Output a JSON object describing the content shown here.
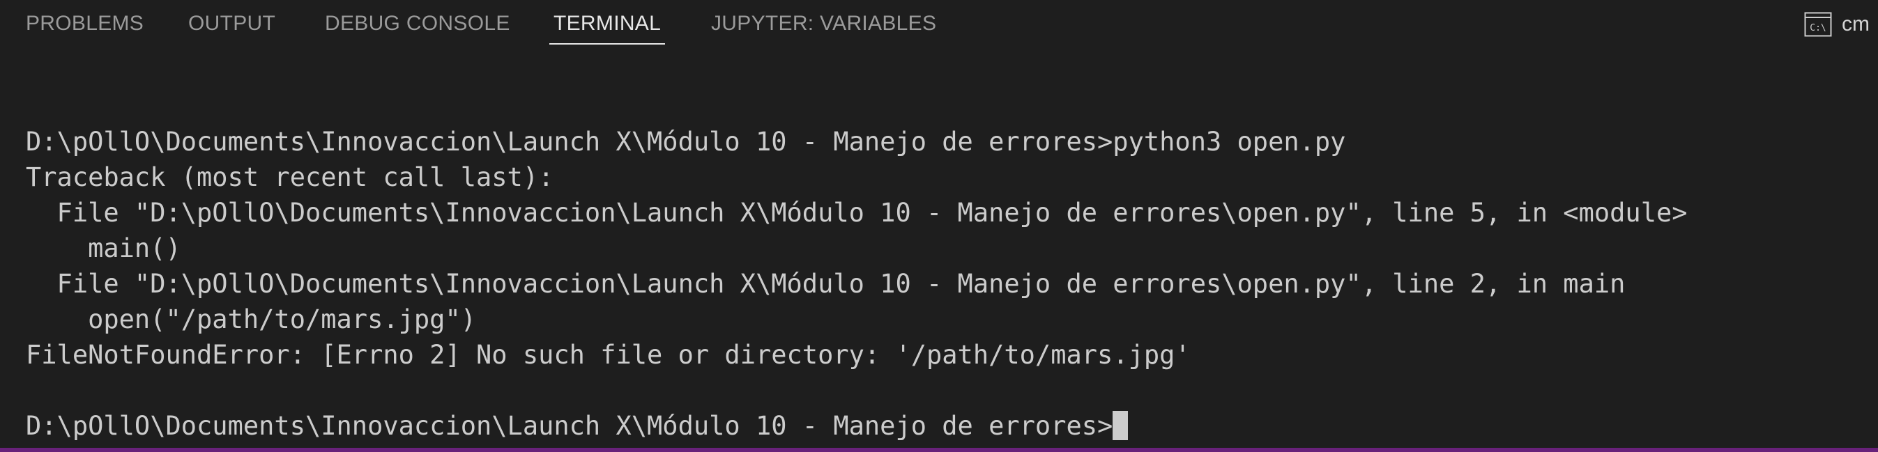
{
  "tabs": [
    {
      "label": "PROBLEMS",
      "active": false
    },
    {
      "label": "OUTPUT",
      "active": false
    },
    {
      "label": "DEBUG CONSOLE",
      "active": false
    },
    {
      "label": "TERMINAL",
      "active": true
    },
    {
      "label": "JUPYTER: VARIABLES",
      "active": false
    }
  ],
  "terminal_selector": {
    "label": "cm",
    "icon": "terminal-cmd-icon"
  },
  "terminal": {
    "lines": [
      "D:\\pOllO\\Documents\\Innovaccion\\Launch X\\Módulo 10 - Manejo de errores>python3 open.py",
      "Traceback (most recent call last):",
      "  File \"D:\\pOllO\\Documents\\Innovaccion\\Launch X\\Módulo 10 - Manejo de errores\\open.py\", line 5, in <module>",
      "    main()",
      "  File \"D:\\pOllO\\Documents\\Innovaccion\\Launch X\\Módulo 10 - Manejo de errores\\open.py\", line 2, in main",
      "    open(\"/path/to/mars.jpg\")",
      "FileNotFoundError: [Errno 2] No such file or directory: '/path/to/mars.jpg'",
      "",
      "D:\\pOllO\\Documents\\Innovaccion\\Launch X\\Módulo 10 - Manejo de errores>"
    ]
  },
  "colors": {
    "background": "#1e1e1e",
    "text": "#cccccc",
    "tab_inactive": "#9b9b9b",
    "tab_active": "#e7e7e7",
    "status_bar_accent": "#68217a"
  }
}
